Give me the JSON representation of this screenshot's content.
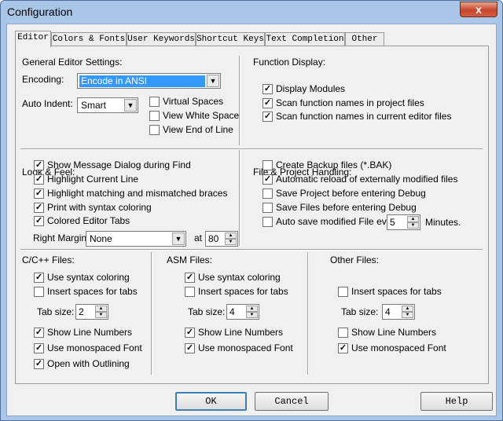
{
  "window": {
    "title": "Configuration",
    "close_glyph": "x"
  },
  "tabs": [
    "Editor",
    "Colors & Fonts",
    "User Keywords",
    "Shortcut Keys",
    "Text Completion",
    "Other"
  ],
  "general": {
    "heading": "General Editor Settings:",
    "encoding_label": "Encoding:",
    "encoding_value": "Encode in ANSI",
    "auto_indent_label": "Auto Indent:",
    "auto_indent_value": "Smart",
    "virtual_spaces": {
      "label": "Virtual Spaces",
      "checked": false
    },
    "view_white_space": {
      "label": "View White Space",
      "checked": false
    },
    "view_end_of_line": {
      "label": "View End of Line",
      "checked": false
    }
  },
  "function_display": {
    "heading": "Function Display:",
    "display_modules": {
      "label": "Display Modules",
      "checked": true
    },
    "scan_project": {
      "label": "Scan function names in project files",
      "checked": true
    },
    "scan_editor": {
      "label": "Scan function names in current editor files",
      "checked": true
    }
  },
  "look_feel": {
    "heading": "Look & Feel:",
    "show_message_dialog": {
      "label": "Show Message Dialog during Find",
      "checked": true
    },
    "highlight_current_line": {
      "label": "Highlight Current Line",
      "checked": true
    },
    "highlight_braces": {
      "label": "Highlight matching and mismatched braces",
      "checked": true
    },
    "print_syntax": {
      "label": "Print with syntax coloring",
      "checked": true
    },
    "colored_tabs": {
      "label": "Colored Editor Tabs",
      "checked": true
    },
    "right_margin_label": "Right Margin:",
    "right_margin_value": "None",
    "at_label": "at",
    "at_value": "80"
  },
  "file_handling": {
    "heading": "File & Project Handling:",
    "create_backup": {
      "label": "Create Backup files (*.BAK)",
      "checked": false
    },
    "auto_reload": {
      "label": "Automatic reload of externally modified files",
      "checked": true
    },
    "save_project": {
      "label": "Save Project before entering Debug",
      "checked": false
    },
    "save_files": {
      "label": "Save Files before entering Debug",
      "checked": false
    },
    "auto_save": {
      "label": "Auto save modified File every",
      "checked": false
    },
    "auto_save_value": "5",
    "minutes_label": "Minutes."
  },
  "cpp_files": {
    "heading": "C/C++ Files:",
    "syntax": {
      "label": "Use syntax coloring",
      "checked": true
    },
    "insert_spaces": {
      "label": "Insert spaces for tabs",
      "checked": false
    },
    "tab_size_label": "Tab size:",
    "tab_size": "2",
    "line_numbers": {
      "label": "Show Line Numbers",
      "checked": true
    },
    "mono_font": {
      "label": "Use monospaced Font",
      "checked": true
    },
    "outlining": {
      "label": "Open with Outlining",
      "checked": true
    }
  },
  "asm_files": {
    "heading": "ASM Files:",
    "syntax": {
      "label": "Use syntax coloring",
      "checked": true
    },
    "insert_spaces": {
      "label": "Insert spaces for tabs",
      "checked": false
    },
    "tab_size_label": "Tab size:",
    "tab_size": "4",
    "line_numbers": {
      "label": "Show Line Numbers",
      "checked": true
    },
    "mono_font": {
      "label": "Use monospaced Font",
      "checked": true
    }
  },
  "other_files": {
    "heading": "Other Files:",
    "insert_spaces": {
      "label": "Insert spaces for tabs",
      "checked": false
    },
    "tab_size_label": "Tab size:",
    "tab_size": "4",
    "line_numbers": {
      "label": "Show Line Numbers",
      "checked": false
    },
    "mono_font": {
      "label": "Use monospaced Font",
      "checked": true
    }
  },
  "buttons": {
    "ok": "OK",
    "cancel": "Cancel",
    "help": "Help"
  },
  "glyphs": {
    "check": "✓",
    "combo_arrow": "▼",
    "spin_up": "▲",
    "spin_down": "▼"
  },
  "colors": {
    "frame": "#a9c6e8",
    "close": "#c7462d",
    "selection": "#3399ff"
  }
}
